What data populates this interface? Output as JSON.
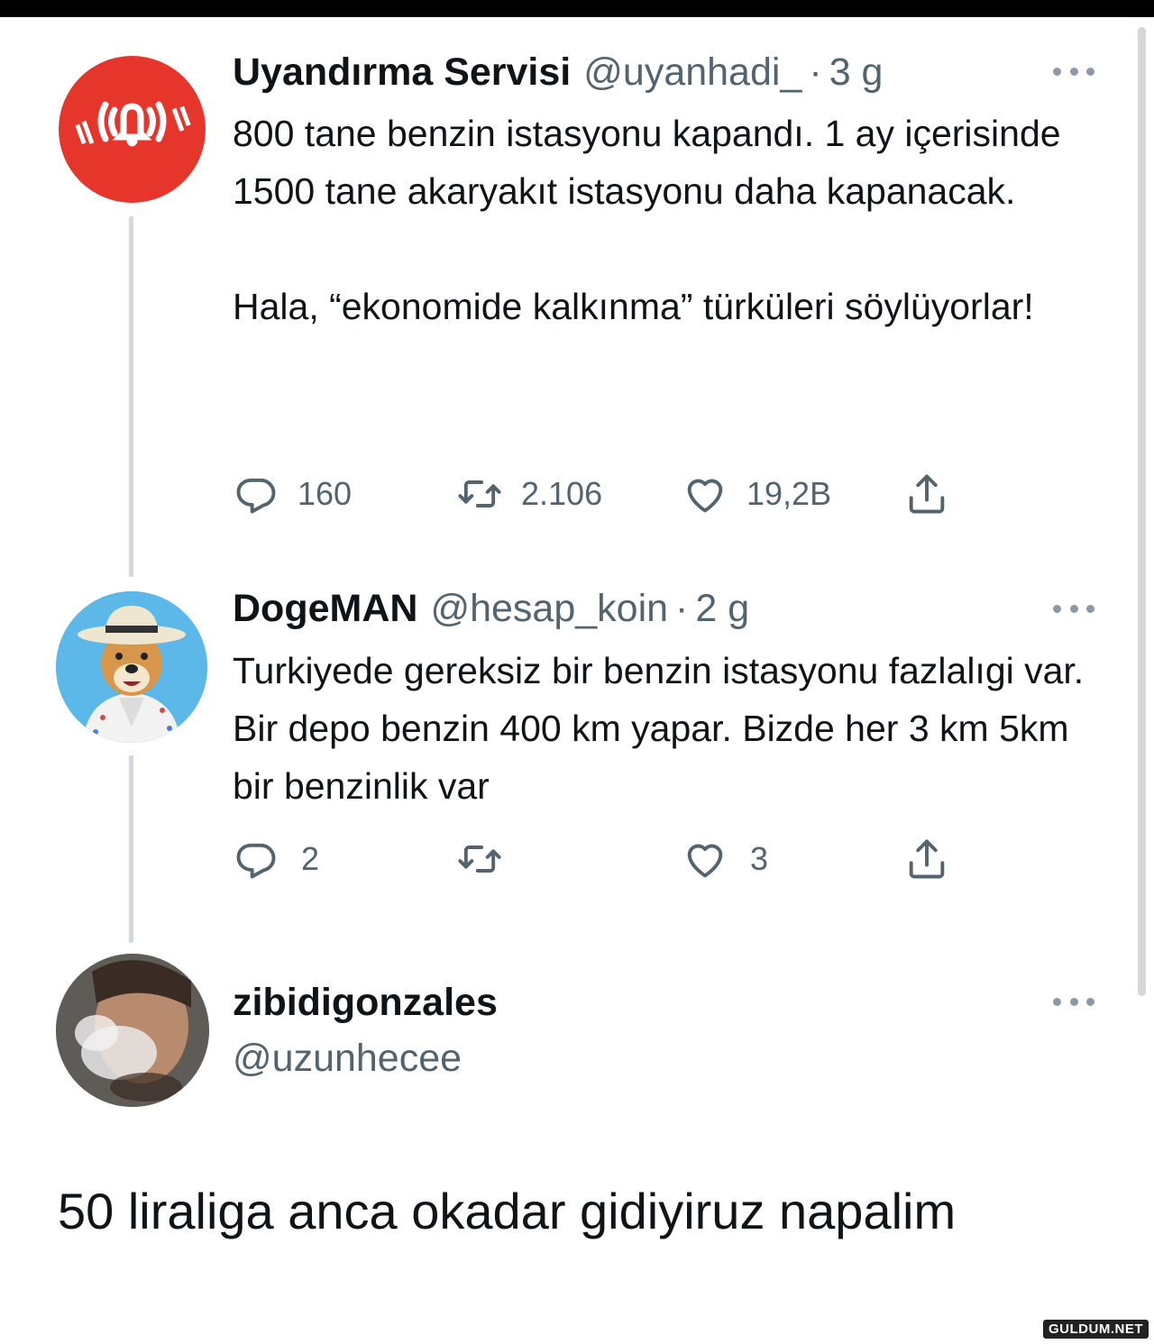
{
  "tweets": [
    {
      "name": "Uyandırma Servisi",
      "handle": "@uyanhadi_",
      "separator": "·",
      "time": "3 g",
      "text": "800 tane benzin istasyonu kapandı. 1 ay içerisinde 1500 tane akaryakıt istasyonu daha kapanacak.\n\nHala, “ekonomide kalkınma” türküleri söylüyorlar!",
      "replies": "160",
      "retweets": "2.106",
      "likes": "19,2B",
      "avatar_color": "#e6352b"
    },
    {
      "name": "DogeMAN",
      "handle": "@hesap_koin",
      "separator": "·",
      "time": "2 g",
      "text": "Turkiyede gereksiz bir benzin istasyonu fazlalıgi var. Bir depo benzin 400 km yapar. Bizde her 3 km 5km bir benzinlik var",
      "replies": "2",
      "retweets": "",
      "likes": "3",
      "avatar_color": "#5bb8e8"
    }
  ],
  "reply": {
    "name": "zibidigonzales",
    "handle": "@uzunhecee",
    "text": "50 liraliga anca okadar gidiyiruz napalim"
  },
  "watermark": "GULDUM.NET",
  "icons": [
    "more-icon",
    "reply-icon",
    "retweet-icon",
    "like-icon",
    "share-icon",
    "bell-icon"
  ]
}
